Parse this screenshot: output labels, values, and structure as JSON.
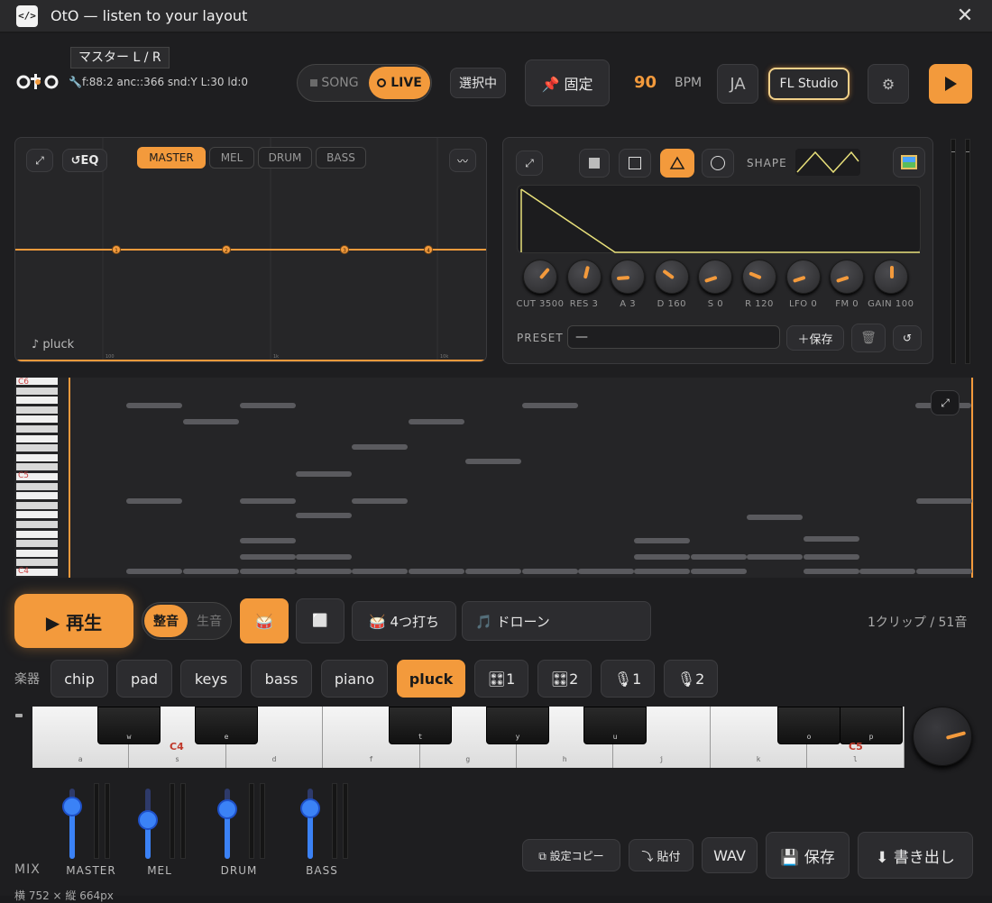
{
  "window": {
    "title": "OtO — listen to your layout",
    "icon": "</>"
  },
  "header": {
    "logo": "oto",
    "master_label": "マスター L / R",
    "status_line": "🔧f:88:2 anc::366 snd:Y L:30 ld:0",
    "mode_song": "SONG",
    "mode_live": "LIVE",
    "select_label": "選択中",
    "pin_label": "📌 固定",
    "bpm_value": "90",
    "bpm_label": "BPM",
    "lang_label": "JA",
    "daw_label": "FL Studio",
    "settings_icon": "gear-icon",
    "play_icon": "play-icon"
  },
  "eq_panel": {
    "expand": "⤢",
    "eq_label": "↺EQ",
    "tabs": [
      "MASTER",
      "MEL",
      "DRUM",
      "BASS"
    ],
    "active_tab": "MASTER",
    "wave_btn": "〰",
    "instrument_label": "♪ pluck",
    "nodes": [
      "1",
      "2",
      "3",
      "4"
    ],
    "axis_ticks": [
      "100",
      "1k",
      "10k"
    ]
  },
  "synth_panel": {
    "expand": "⤢",
    "shape_label": "SHAPE",
    "knobs": [
      {
        "label": "CUT 3500",
        "value": 0.65
      },
      {
        "label": "RES 3",
        "value": 0.55
      },
      {
        "label": "A 3",
        "value": 0.15
      },
      {
        "label": "D 160",
        "value": 0.3
      },
      {
        "label": "S 0",
        "value": 0.1
      },
      {
        "label": "R 120",
        "value": 0.25
      },
      {
        "label": "LFO 0",
        "value": 0.1
      },
      {
        "label": "FM 0",
        "value": 0.1
      },
      {
        "label": "GAIN 100",
        "value": 0.5
      }
    ],
    "preset_label": "PRESET",
    "preset_value": "—",
    "save_label": "＋保存",
    "delete_icon": "trash-icon",
    "reset_label": "↺"
  },
  "roll": {
    "labels": [
      "C6",
      "C5",
      "C4"
    ],
    "expand": "⤢"
  },
  "transport": {
    "play_label": "▶ 再生",
    "tune_on": "整音",
    "tune_off": "生音",
    "drum_icon": "🥁",
    "grid_icon": "⬜",
    "four_beat": "🥁 4つ打ち",
    "drone": "🎵 ドローン",
    "clip_info": "1クリップ / 51音"
  },
  "instruments": {
    "label": "楽器",
    "items": [
      "chip",
      "pad",
      "keys",
      "bass",
      "piano",
      "pluck",
      "🎛1",
      "🎛2",
      "🎙1",
      "🎙2"
    ],
    "active": "pluck"
  },
  "keyboard": {
    "white_keys": [
      "a",
      "s",
      "d",
      "f",
      "g",
      "h",
      "j",
      "k",
      "l"
    ],
    "black_keys": [
      "w",
      "e",
      "t",
      "y",
      "u",
      "o",
      "p"
    ],
    "c4": "C4",
    "c5": "C5"
  },
  "mixer": {
    "label": "MIX",
    "channels": [
      {
        "name": "MASTER",
        "level": 0.75
      },
      {
        "name": "MEL",
        "level": 0.55
      },
      {
        "name": "DRUM",
        "level": 0.7
      },
      {
        "name": "BASS",
        "level": 0.72
      }
    ],
    "copy_label": "⧉ 設定コピー",
    "paste_label": "⤵ 貼付",
    "wav_label": "WAV",
    "save_label": "💾 保存",
    "export_label": "⬇ 書き出し",
    "size_label": "横 752 × 縦 664px"
  }
}
